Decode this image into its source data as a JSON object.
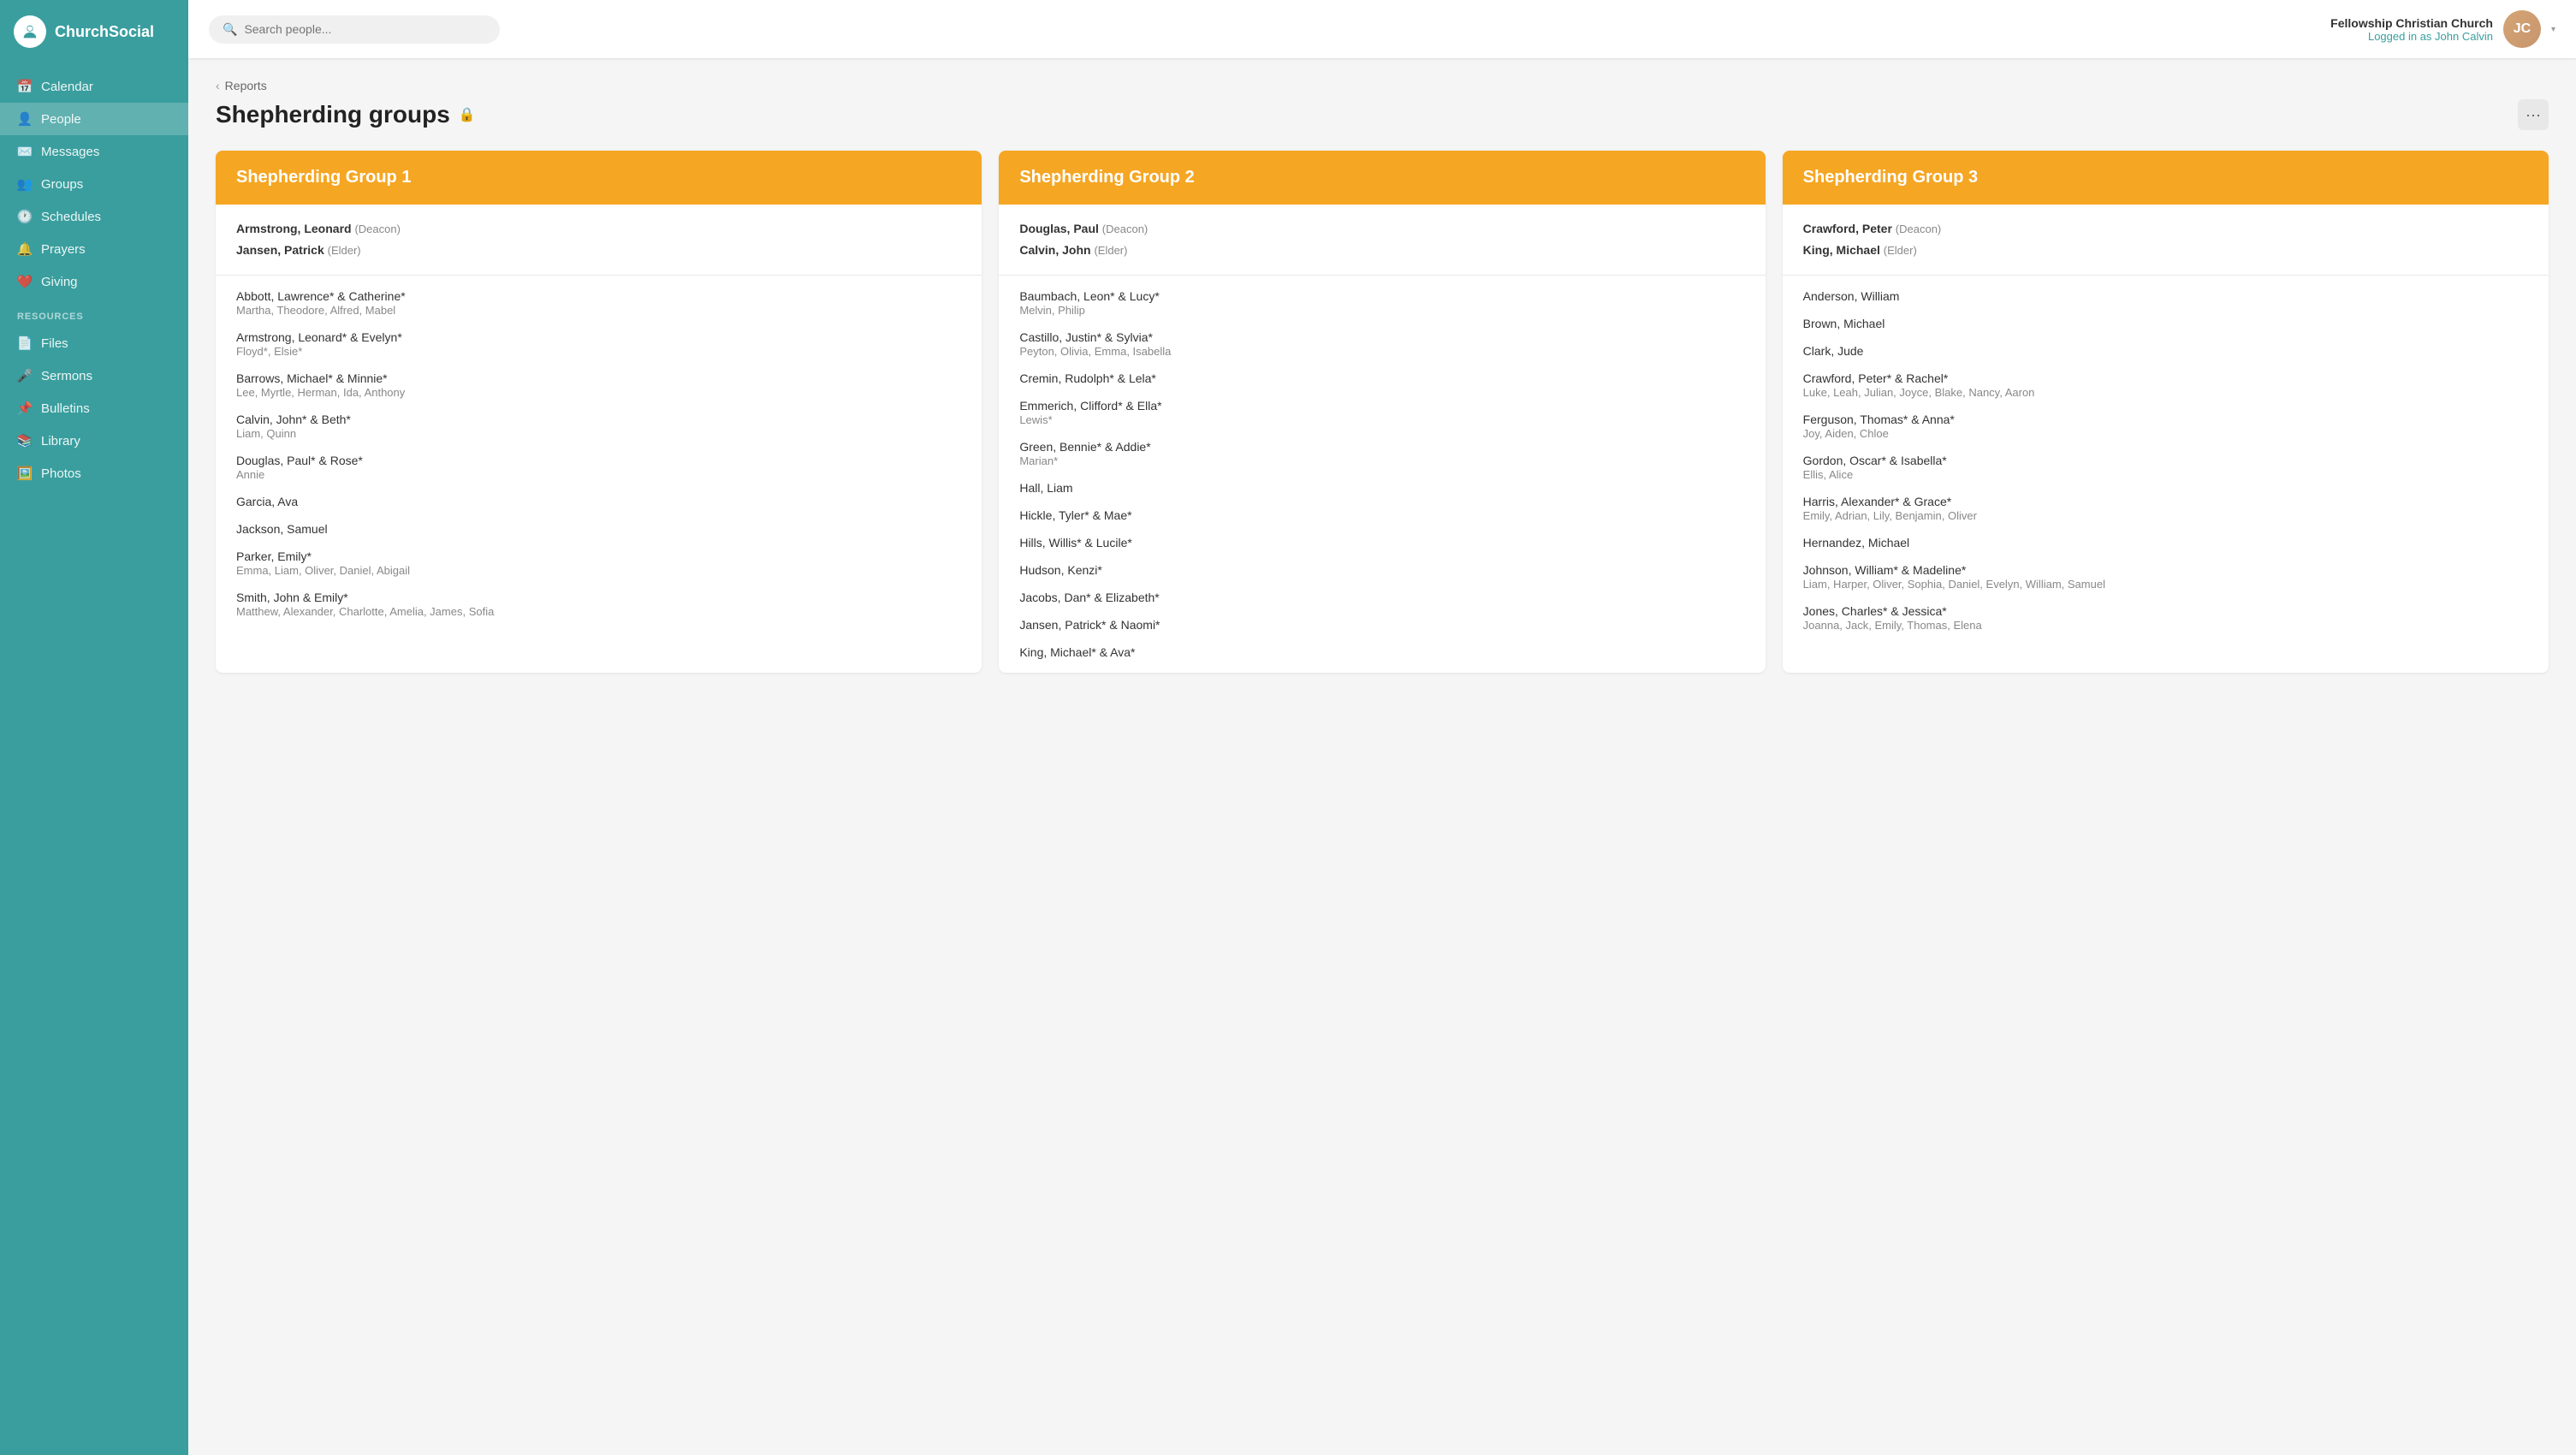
{
  "app": {
    "name": "ChurchSocial"
  },
  "header": {
    "search_placeholder": "Search people...",
    "church_name": "Fellowship Christian Church",
    "logged_in_text": "Logged in as John Calvin"
  },
  "sidebar": {
    "nav_items": [
      {
        "id": "calendar",
        "label": "Calendar",
        "icon": "calendar"
      },
      {
        "id": "people",
        "label": "People",
        "icon": "people",
        "active": true
      },
      {
        "id": "messages",
        "label": "Messages",
        "icon": "messages"
      },
      {
        "id": "groups",
        "label": "Groups",
        "icon": "groups"
      },
      {
        "id": "schedules",
        "label": "Schedules",
        "icon": "schedules"
      },
      {
        "id": "prayers",
        "label": "Prayers",
        "icon": "prayers"
      },
      {
        "id": "giving",
        "label": "Giving",
        "icon": "giving"
      }
    ],
    "resources_label": "RESOURCES",
    "resource_items": [
      {
        "id": "files",
        "label": "Files",
        "icon": "files"
      },
      {
        "id": "sermons",
        "label": "Sermons",
        "icon": "sermons"
      },
      {
        "id": "bulletins",
        "label": "Bulletins",
        "icon": "bulletins"
      },
      {
        "id": "library",
        "label": "Library",
        "icon": "library"
      },
      {
        "id": "photos",
        "label": "Photos",
        "icon": "photos"
      }
    ]
  },
  "page": {
    "breadcrumb": "Reports",
    "title": "Shepherding groups",
    "more_btn_label": "···"
  },
  "groups": [
    {
      "id": "group1",
      "title": "Shepherding Group 1",
      "leaders": [
        {
          "name": "Armstrong, Leonard",
          "role": "Deacon"
        },
        {
          "name": "Jansen, Patrick",
          "role": "Elder"
        }
      ],
      "families": [
        {
          "name": "Abbott, Lawrence* & Catherine*",
          "children": "Martha, Theodore, Alfred, Mabel"
        },
        {
          "name": "Armstrong, Leonard* & Evelyn*",
          "children": "Floyd*, Elsie*"
        },
        {
          "name": "Barrows, Michael* & Minnie*",
          "children": "Lee, Myrtle, Herman, Ida, Anthony"
        },
        {
          "name": "Calvin, John* & Beth*",
          "children": "Liam, Quinn"
        },
        {
          "name": "Douglas, Paul* & Rose*",
          "children": "Annie"
        },
        {
          "name": "Garcia, Ava",
          "children": ""
        },
        {
          "name": "Jackson, Samuel",
          "children": ""
        },
        {
          "name": "Parker, Emily*",
          "children": "Emma, Liam, Oliver, Daniel, Abigail"
        },
        {
          "name": "Smith, John & Emily*",
          "children": "Matthew, Alexander, Charlotte, Amelia, James, Sofia"
        }
      ]
    },
    {
      "id": "group2",
      "title": "Shepherding Group 2",
      "leaders": [
        {
          "name": "Douglas, Paul",
          "role": "Deacon"
        },
        {
          "name": "Calvin, John",
          "role": "Elder"
        }
      ],
      "families": [
        {
          "name": "Baumbach, Leon* & Lucy*",
          "children": "Melvin, Philip"
        },
        {
          "name": "Castillo, Justin* & Sylvia*",
          "children": "Peyton, Olivia, Emma, Isabella"
        },
        {
          "name": "Cremin, Rudolph* & Lela*",
          "children": ""
        },
        {
          "name": "Emmerich, Clifford* & Ella*",
          "children": "Lewis*"
        },
        {
          "name": "Green, Bennie* & Addie*",
          "children": "Marian*"
        },
        {
          "name": "Hall, Liam",
          "children": ""
        },
        {
          "name": "Hickle, Tyler* & Mae*",
          "children": ""
        },
        {
          "name": "Hills, Willis* & Lucile*",
          "children": ""
        },
        {
          "name": "Hudson, Kenzi*",
          "children": ""
        },
        {
          "name": "Jacobs, Dan* & Elizabeth*",
          "children": ""
        },
        {
          "name": "Jansen, Patrick* & Naomi*",
          "children": ""
        },
        {
          "name": "King, Michael* & Ava*",
          "children": ""
        }
      ]
    },
    {
      "id": "group3",
      "title": "Shepherding Group 3",
      "leaders": [
        {
          "name": "Crawford, Peter",
          "role": "Deacon"
        },
        {
          "name": "King, Michael",
          "role": "Elder"
        }
      ],
      "families": [
        {
          "name": "Anderson, William",
          "children": ""
        },
        {
          "name": "Brown, Michael",
          "children": ""
        },
        {
          "name": "Clark, Jude",
          "children": ""
        },
        {
          "name": "Crawford, Peter* & Rachel*",
          "children": "Luke, Leah, Julian, Joyce, Blake, Nancy, Aaron"
        },
        {
          "name": "Ferguson, Thomas* & Anna*",
          "children": "Joy, Aiden, Chloe"
        },
        {
          "name": "Gordon, Oscar* & Isabella*",
          "children": "Ellis, Alice"
        },
        {
          "name": "Harris, Alexander* & Grace*",
          "children": "Emily, Adrian, Lily, Benjamin, Oliver"
        },
        {
          "name": "Hernandez, Michael",
          "children": ""
        },
        {
          "name": "Johnson, William* & Madeline*",
          "children": "Liam, Harper, Oliver, Sophia, Daniel, Evelyn, William, Samuel"
        },
        {
          "name": "Jones, Charles* & Jessica*",
          "children": "Joanna, Jack, Emily, Thomas, Elena"
        }
      ]
    }
  ]
}
